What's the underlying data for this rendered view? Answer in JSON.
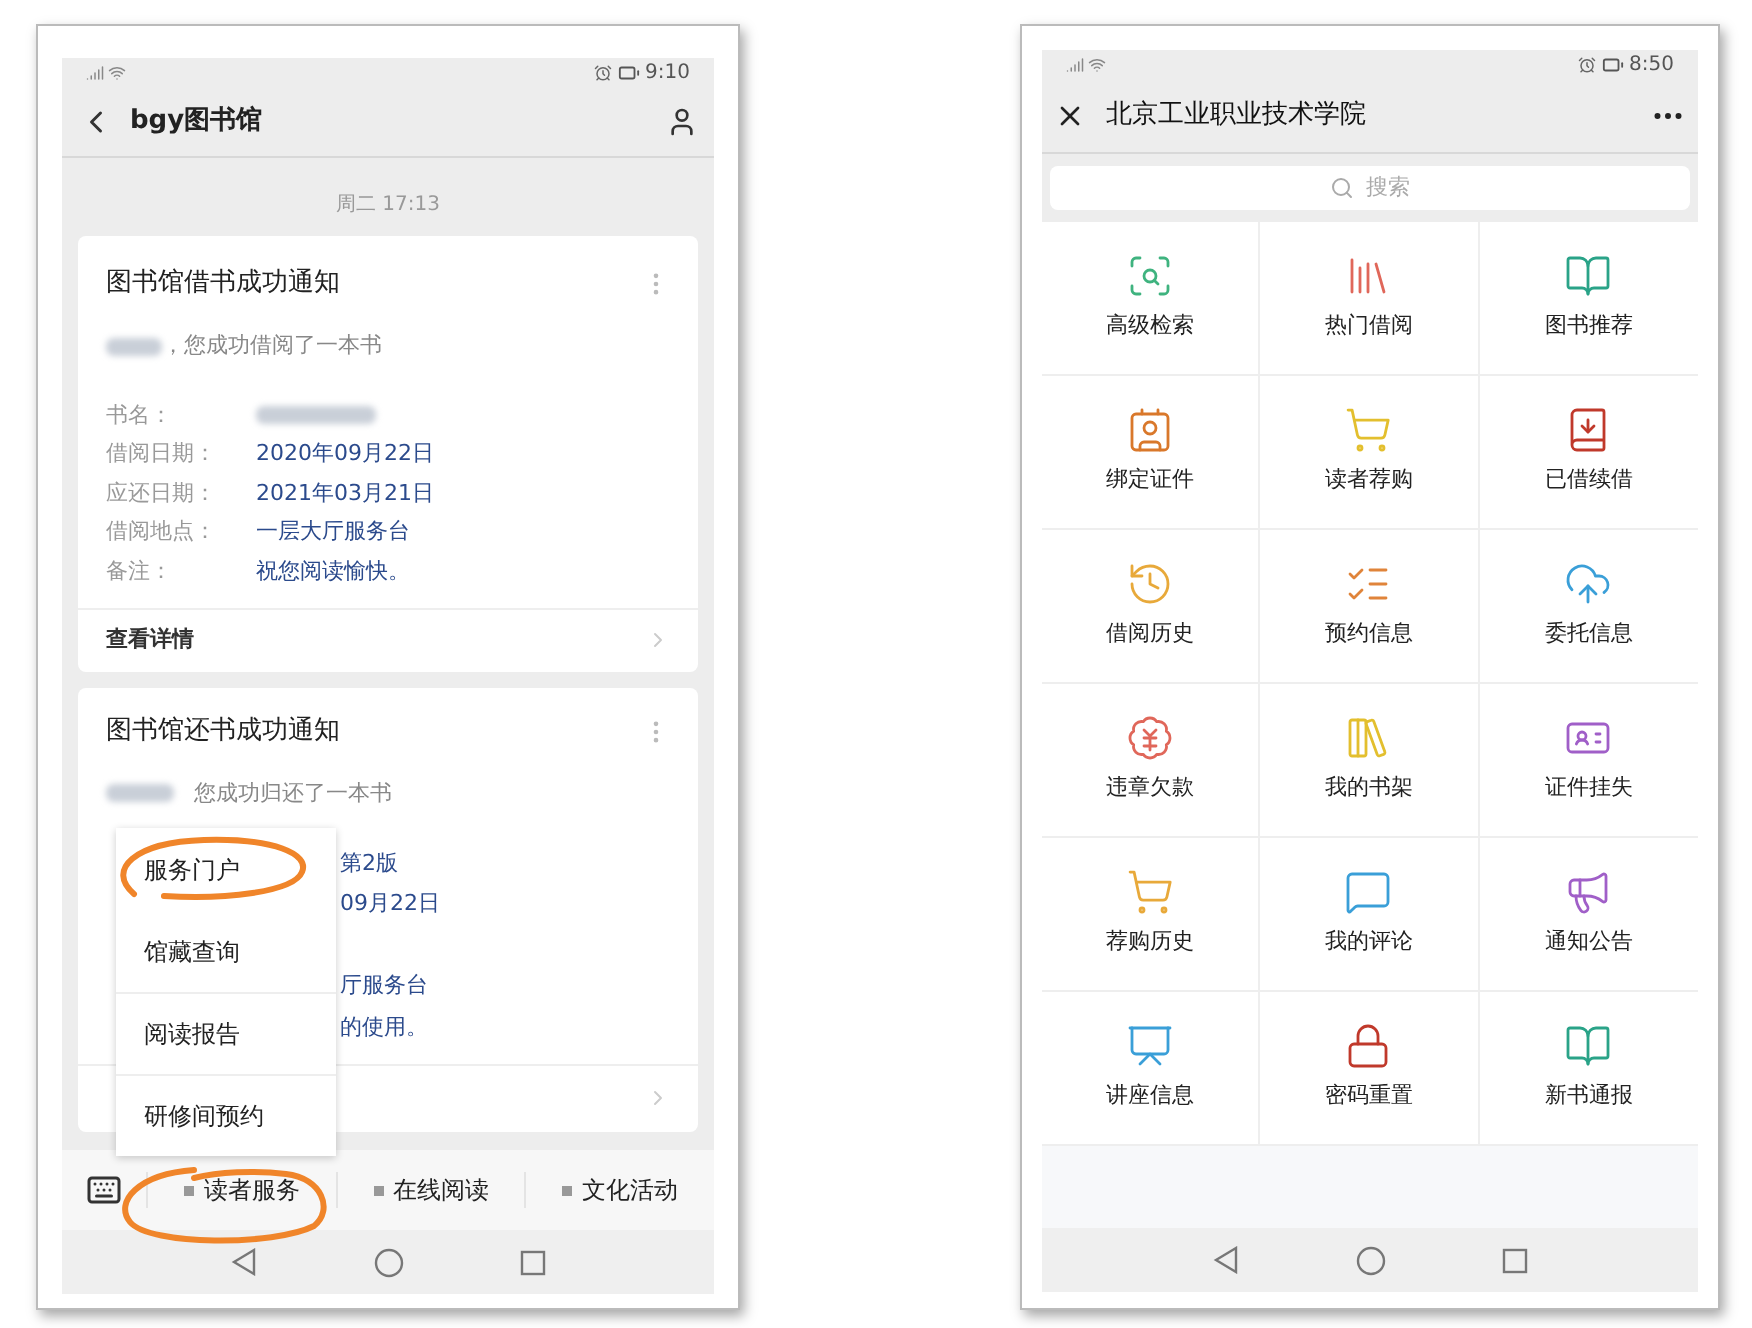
{
  "left_phone": {
    "status_bar": {
      "time": "9:10"
    },
    "nav": {
      "title": "bgy图书馆"
    },
    "timestamp": "周二 17:13",
    "borrow_card": {
      "title": "图书馆借书成功通知",
      "greeting": "，您成功借阅了一本书",
      "fields": [
        {
          "label": "书名：",
          "value_redacted": true
        },
        {
          "label": "借阅日期：",
          "value": "2020年09月22日"
        },
        {
          "label": "应还日期：",
          "value": "2021年03月21日"
        },
        {
          "label": "借阅地点：",
          "value": "一层大厅服务台"
        },
        {
          "label": "备注：",
          "value": "祝您阅读愉快。"
        }
      ],
      "footer": "查看详情"
    },
    "return_card": {
      "title": "图书馆还书成功通知",
      "greeting": "您成功归还了一本书",
      "visible_values": [
        "第2版",
        "09月22日",
        "厅服务台",
        "的使用。"
      ]
    },
    "popup_menu": {
      "items": [
        {
          "label": "服务门户"
        },
        {
          "label": "馆藏查询"
        },
        {
          "label": "阅读报告"
        },
        {
          "label": "研修间预约"
        }
      ]
    },
    "menu_bar": {
      "items": [
        {
          "label": "读者服务"
        },
        {
          "label": "在线阅读"
        },
        {
          "label": "文化活动"
        }
      ]
    }
  },
  "right_phone": {
    "status_bar": {
      "time": "8:50"
    },
    "nav": {
      "title": "北京工业职业技术学院"
    },
    "search": {
      "placeholder": "搜索"
    },
    "grid": {
      "items": [
        {
          "label": "高级检索"
        },
        {
          "label": "热门借阅"
        },
        {
          "label": "图书推荐"
        },
        {
          "label": "绑定证件"
        },
        {
          "label": "读者荐购"
        },
        {
          "label": "已借续借"
        },
        {
          "label": "借阅历史"
        },
        {
          "label": "预约信息"
        },
        {
          "label": "委托信息"
        },
        {
          "label": "违章欠款"
        },
        {
          "label": "我的书架"
        },
        {
          "label": "证件挂失"
        },
        {
          "label": "荐购历史"
        },
        {
          "label": "我的评论"
        },
        {
          "label": "通知公告"
        },
        {
          "label": "讲座信息"
        },
        {
          "label": "密码重置"
        },
        {
          "label": "新书通报"
        }
      ]
    }
  }
}
